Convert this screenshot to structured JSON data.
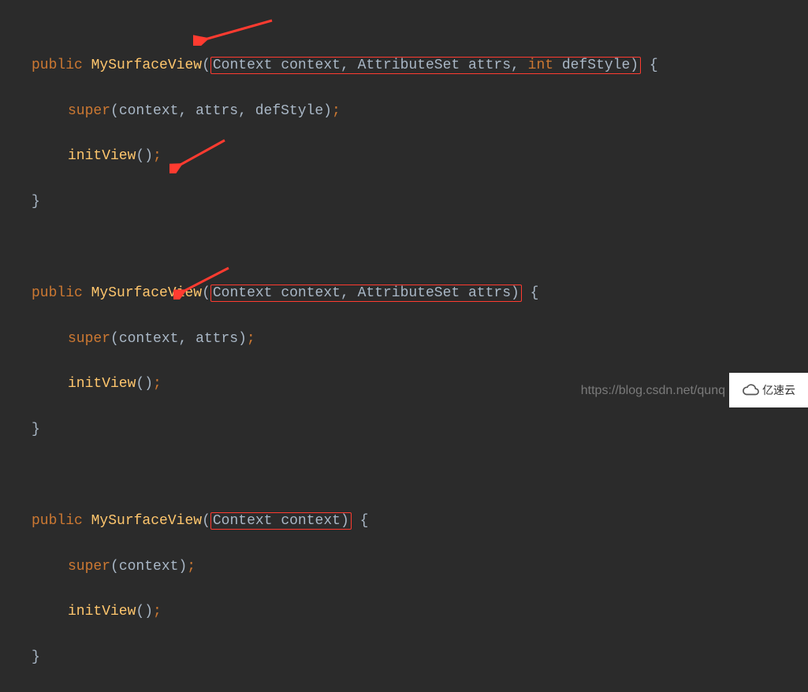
{
  "code": {
    "kw_public": "public",
    "kw_int": "int",
    "kw_super": "super",
    "class_name": "MySurfaceView",
    "t_context": "Context",
    "p_context": "context",
    "t_attrs": "AttributeSet",
    "p_attrs": "attrs",
    "p_defstyle": "defStyle",
    "m_init": "initView",
    "paren_o": "(",
    "paren_c": ")",
    "comma": ",",
    "semi": ";",
    "brace_o": "{",
    "brace_c": "}",
    "sp": " "
  },
  "watermark": {
    "url": "https://blog.csdn.net/qunq",
    "logo_text": "亿速云"
  }
}
